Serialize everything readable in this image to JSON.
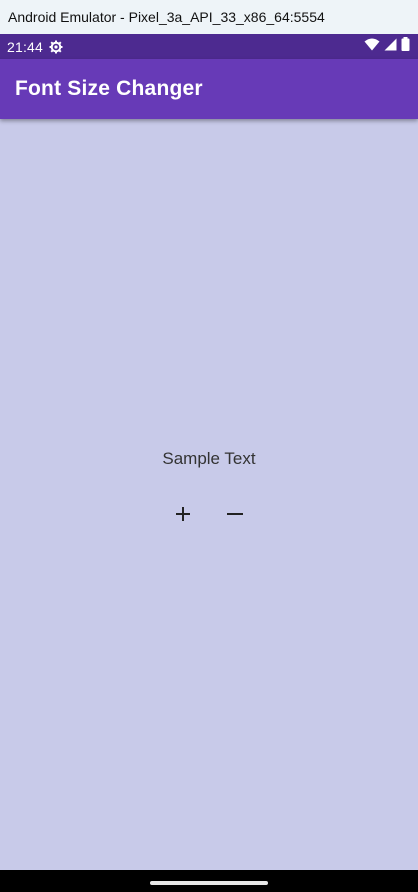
{
  "window": {
    "title": "Android Emulator - Pixel_3a_API_33_x86_64:5554"
  },
  "status_bar": {
    "time": "21:44",
    "icons": [
      "settings-gear-icon",
      "wifi-icon",
      "signal-icon",
      "battery-icon"
    ]
  },
  "app_bar": {
    "title": "Font Size Changer"
  },
  "main": {
    "sample_text": "Sample Text",
    "increase_icon": "plus-icon",
    "decrease_icon": "minus-icon"
  },
  "colors": {
    "status_bar": "#4d2a90",
    "app_bar": "#673ab7",
    "background": "#c8cae9"
  }
}
